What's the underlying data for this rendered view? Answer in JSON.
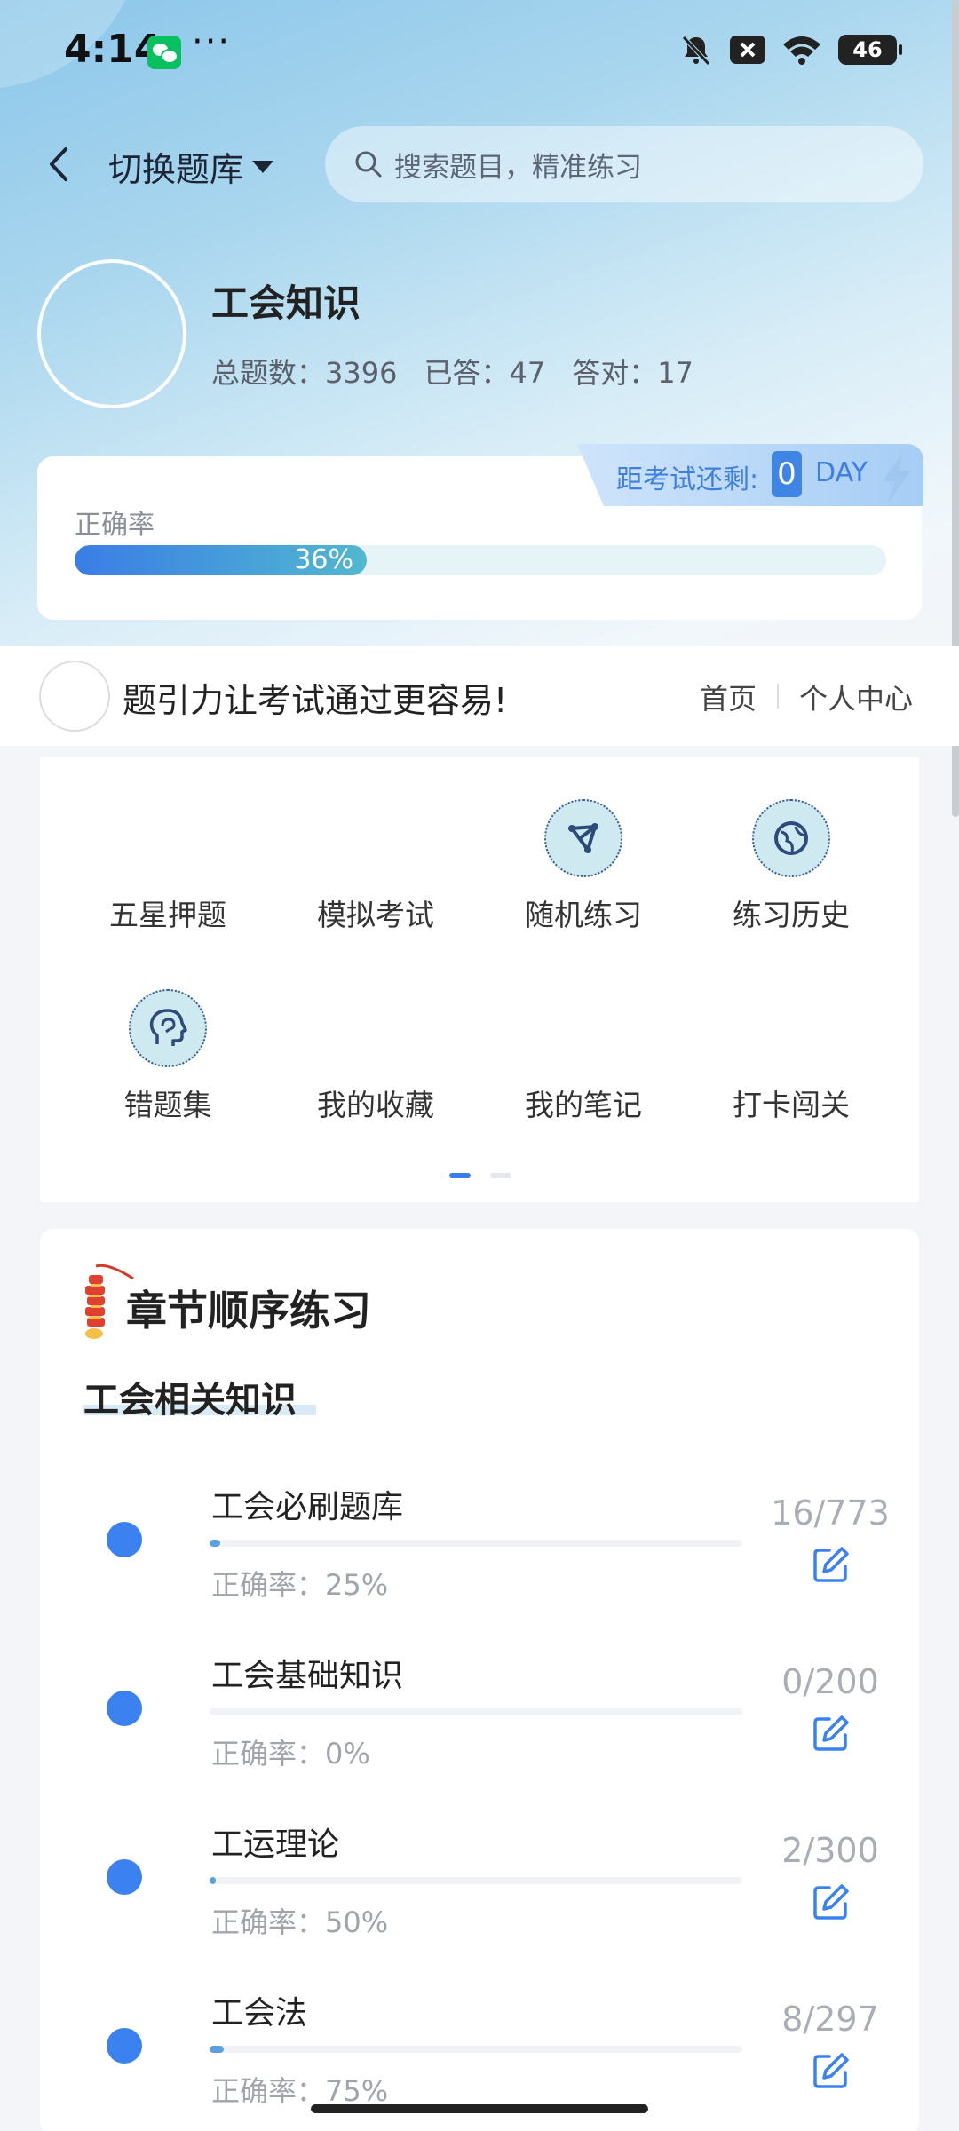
{
  "status_bar": {
    "time": "4:14",
    "more": "···",
    "battery": "46"
  },
  "header": {
    "switch_bank": "切换题库",
    "search_placeholder": "搜索题目，精准练习"
  },
  "profile": {
    "subject": "工会知识",
    "total_label": "总题数：3396",
    "answered_label": "已答：47",
    "correct_label": "答对：17"
  },
  "accuracy": {
    "label": "正确率",
    "percent_text": "36%",
    "percent_value": 36,
    "countdown_label": "距考试还剩:",
    "countdown_days": "0",
    "countdown_unit": "DAY"
  },
  "slogan": {
    "text": "题引力让考试通过更容易!",
    "nav_home": "首页",
    "nav_profile": "个人中心"
  },
  "grid": {
    "items": [
      {
        "label": "五星押题",
        "icon": "none"
      },
      {
        "label": "模拟考试",
        "icon": "none"
      },
      {
        "label": "随机练习",
        "icon": "network-icon"
      },
      {
        "label": "练习历史",
        "icon": "globe-icon"
      },
      {
        "label": "错题集",
        "icon": "brain-head-icon"
      },
      {
        "label": "我的收藏",
        "icon": "none"
      },
      {
        "label": "我的笔记",
        "icon": "none"
      },
      {
        "label": "打卡闯关",
        "icon": "none"
      }
    ],
    "page_count": 2,
    "active_page": 1
  },
  "chapters": {
    "title": "章节顺序练习",
    "section": "工会相关知识",
    "rows": [
      {
        "name": "工会必刷题库",
        "accuracy": "正确率：25%",
        "count": "16/773",
        "progress": 0.0207
      },
      {
        "name": "工会基础知识",
        "accuracy": "正确率：0%",
        "count": "0/200",
        "progress": 0
      },
      {
        "name": "工运理论",
        "accuracy": "正确率：50%",
        "count": "2/300",
        "progress": 0.0067
      },
      {
        "name": "工会法",
        "accuracy": "正确率：75%",
        "count": "8/297",
        "progress": 0.0269
      }
    ]
  },
  "colors": {
    "accent": "#3a7de6",
    "dot": "#3b82f0",
    "edit": "#3b82f0"
  }
}
